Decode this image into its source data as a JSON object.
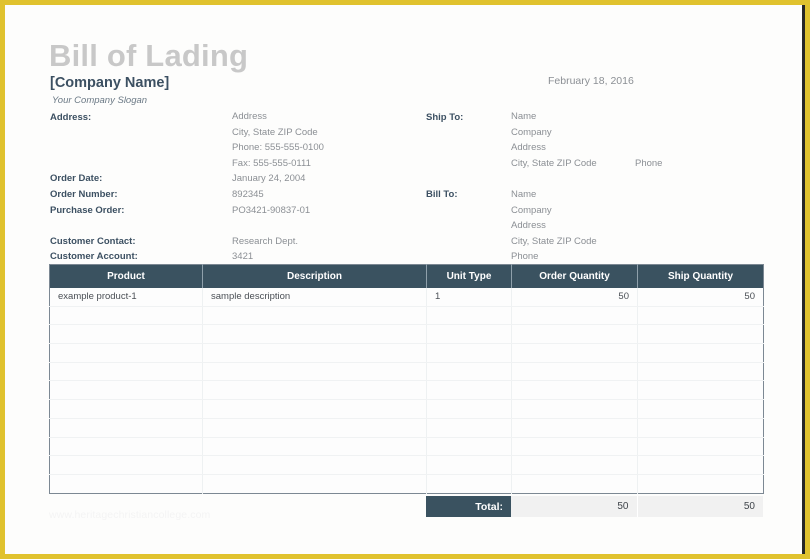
{
  "document": {
    "title": "Bill of Lading",
    "company_name": "[Company Name]",
    "slogan": "Your Company Slogan",
    "date": "February 18, 2016",
    "watermark": "www.heritagechristiancollege.com"
  },
  "colors": {
    "frame": "#e0c22e",
    "header_fill": "#3a5260",
    "title_grey": "#c8c8c8",
    "label_slate": "#3c5062",
    "value_grey": "#8b8f94",
    "total_cell": "#f1f1f1"
  },
  "seller": {
    "address_label": "Address:",
    "address_lines": [
      "Address",
      "City, State ZIP Code",
      "Phone: 555-555-0100",
      "Fax: 555-555-0111"
    ],
    "order_date_label": "Order Date:",
    "order_date_value": "January 24, 2004",
    "order_number_label": "Order Number:",
    "order_number_value": "892345",
    "purchase_order_label": "Purchase Order:",
    "purchase_order_value": "PO3421-90837-01",
    "customer_contact_label": "Customer Contact:",
    "customer_contact_value": "Research Dept.",
    "customer_account_label": "Customer Account:",
    "customer_account_value": "3421"
  },
  "ship_to": {
    "label": "Ship To:",
    "name": "Name",
    "company": "Company",
    "address": "Address",
    "city_state_zip": "City, State ZIP Code",
    "phone": "Phone"
  },
  "bill_to": {
    "label": "Bill To:",
    "name": "Name",
    "company": "Company",
    "address": "Address",
    "city_state_zip": "City, State ZIP Code",
    "phone": "Phone"
  },
  "table": {
    "columns": [
      "Product",
      "Description",
      "Unit Type",
      "Order Quantity",
      "Ship Quantity"
    ],
    "rows": [
      {
        "product": "example product-1",
        "description": "sample description",
        "unit_type": "1",
        "order_quantity": "50",
        "ship_quantity": "50"
      }
    ],
    "empty_row_count": 10,
    "total_label": "Total:",
    "total_order_quantity": "50",
    "total_ship_quantity": "50"
  }
}
